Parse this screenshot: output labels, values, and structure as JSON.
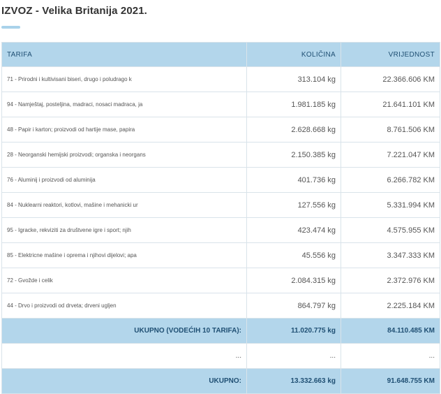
{
  "title": "IZVOZ - Velika Britanija 2021.",
  "headers": {
    "tarifa": "TARIFA",
    "kolicina": "KOLIČINA",
    "vrijednost": "VRIJEDNOST"
  },
  "rows": [
    {
      "tarifa": "71 - Prirodni i kultivisani biseri, drugo i poludrago k",
      "kolicina": "313.104 kg",
      "vrijednost": "22.366.606 KM"
    },
    {
      "tarifa": "94 - Namještaj, posteljina, madraci, nosaci madraca, ja",
      "kolicina": "1.981.185 kg",
      "vrijednost": "21.641.101 KM"
    },
    {
      "tarifa": "48 - Papir i karton; proizvodi od hartije mase, papira",
      "kolicina": "2.628.668 kg",
      "vrijednost": "8.761.506 KM"
    },
    {
      "tarifa": "28 - Neorganski hemijski proizvodi; organska i neorgans",
      "kolicina": "2.150.385 kg",
      "vrijednost": "7.221.047 KM"
    },
    {
      "tarifa": "76 - Aluminij i proizvodi od aluminija",
      "kolicina": "401.736 kg",
      "vrijednost": "6.266.782 KM"
    },
    {
      "tarifa": "84 - Nuklearni reaktori, kotlovi, mašine i mehanicki ur",
      "kolicina": "127.556 kg",
      "vrijednost": "5.331.994 KM"
    },
    {
      "tarifa": "95 - Igracke, rekviziti za društvene igre i sport; njih",
      "kolicina": "423.474 kg",
      "vrijednost": "4.575.955 KM"
    },
    {
      "tarifa": "85 - Elektricne mašine i oprema i njihovi dijelovi; apa",
      "kolicina": "45.556 kg",
      "vrijednost": "3.347.333 KM"
    },
    {
      "tarifa": "72 - Gvožde i celik",
      "kolicina": "2.084.315 kg",
      "vrijednost": "2.372.976 KM"
    },
    {
      "tarifa": "44 - Drvo i proizvodi od drveta; drveni ugljen",
      "kolicina": "864.797 kg",
      "vrijednost": "2.225.184 KM"
    }
  ],
  "subtotal": {
    "label": "UKUPNO (VODEĆIH 10 TARIFA):",
    "kolicina": "11.020.775 kg",
    "vrijednost": "84.110.485 KM"
  },
  "ellipsis": {
    "label": "...",
    "kolicina": "...",
    "vrijednost": "..."
  },
  "total": {
    "label": "UKUPNO:",
    "kolicina": "13.332.663 kg",
    "vrijednost": "91.648.755 KM"
  }
}
